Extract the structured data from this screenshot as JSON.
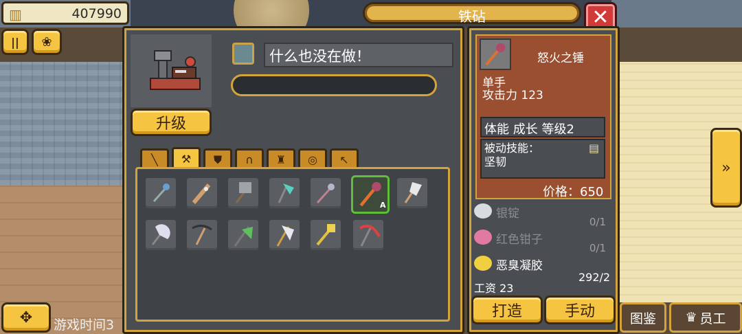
{
  "hud": {
    "money": "407990",
    "game_time": "游戏时间3",
    "atlas_label": "图鉴",
    "staff_label": "员工"
  },
  "workstation": {
    "title": "铁砧",
    "upgrade_label": "升级",
    "status_text": "什么也没在做！",
    "progress": 0,
    "tabs": [
      "sword",
      "axe",
      "shield",
      "helmet",
      "armor",
      "ring",
      "pickaxe"
    ],
    "active_tab": 1,
    "selected_badge": "A"
  },
  "item": {
    "name": "怒火之锤",
    "hands": "单手",
    "attack": "攻击力 123",
    "traits": "体能 成长 等级2",
    "passive_label": "被动技能：",
    "passive_value": "坚韧",
    "price": "价格：650"
  },
  "materials": [
    {
      "name": "银锭",
      "count": "0/1",
      "color": "#d8dce0",
      "text_color": "#8a8e92"
    },
    {
      "name": "红色钳子",
      "count": "0/1",
      "color": "#e07aa0",
      "text_color": "#8a8e92"
    },
    {
      "name": "恶臭凝胶",
      "count": "292/2",
      "color": "#f0d040",
      "text_color": "#ffffff"
    }
  ],
  "wage": "工资 23",
  "actions": {
    "craft": "打造",
    "manual": "手动"
  },
  "colors": {
    "accent_gold": "#f5c542",
    "panel_bg": "#4a4e52",
    "item_card": "#9a5030",
    "close_red": "#d23a3a"
  }
}
